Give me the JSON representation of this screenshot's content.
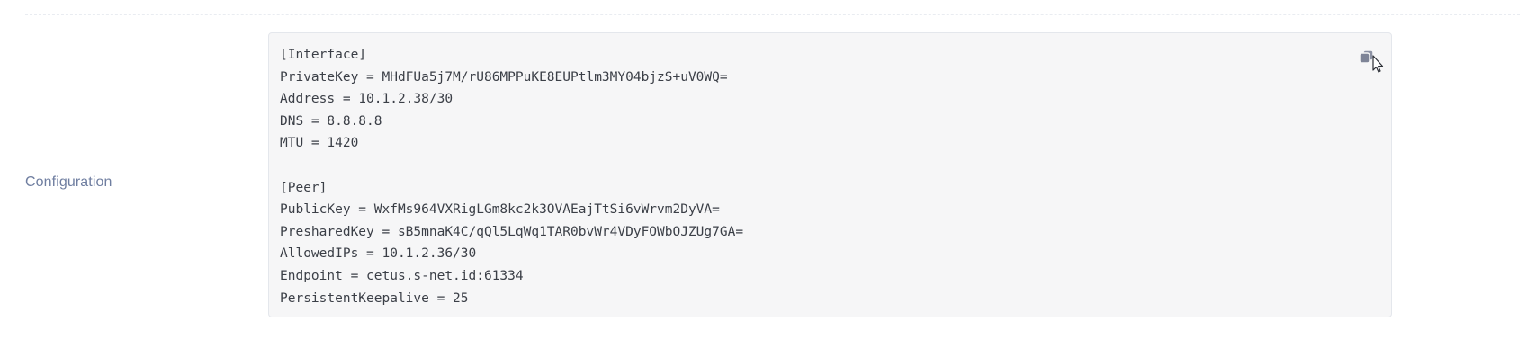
{
  "config": {
    "label": "Configuration",
    "lines": [
      "[Interface]",
      "PrivateKey = MHdFUa5j7M/rU86MPPuKE8EUPtlm3MY04bjzS+uV0WQ=",
      "Address = 10.1.2.38/30",
      "DNS = 8.8.8.8",
      "MTU = 1420",
      "",
      "[Peer]",
      "PublicKey = WxfMs964VXRigLGm8kc2k3OVAEajTtSi6vWrvm2DyVA=",
      "PresharedKey = sB5mnaK4C/qQl5LqWq1TAR0bvWr4VDyFOWbOJZUg7GA=",
      "AllowedIPs = 10.1.2.36/30",
      "Endpoint = cetus.s-net.id:61334",
      "PersistentKeepalive = 25"
    ],
    "copy_icon": "copy-icon",
    "cursor_icon": "mouse-pointer-icon"
  }
}
